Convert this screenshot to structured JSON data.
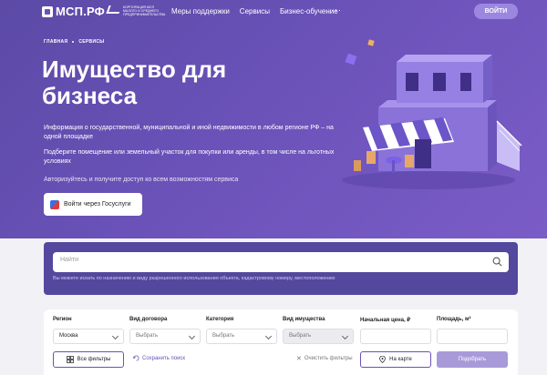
{
  "header": {
    "logo": "МСП.РФ",
    "corp_caption": "Корпорация МСП малого и среднего предпринимательства",
    "nav": [
      "Меры поддержки",
      "Сервисы",
      "Бизнес-обучение"
    ],
    "more": "···",
    "login_label": "ВОЙТИ"
  },
  "breadcrumb": [
    "ГЛАВНАЯ",
    "СЕРВИСЫ"
  ],
  "hero": {
    "title": "Имущество для бизнеса",
    "desc1": "Информация о государственной, муниципальной и иной недвижимости в любом регионе РФ – на одной площадке",
    "desc2": "Подберите помещение или земельный участок для покупки или аренды, в том числе на льготных условиях",
    "desc3": "Авторизуйтесь и получите доступ ко всем возможностям сервиса",
    "gos_button": "Войти через Госуслуги"
  },
  "search": {
    "placeholder": "Найти",
    "hint": "Вы можете искать по назначению и виду разрешенного использования объекта, кадастровому номеру, местоположению"
  },
  "filters": {
    "region": {
      "label": "Регион",
      "value": "Москва"
    },
    "contract": {
      "label": "Вид договора",
      "value": "Выбрать"
    },
    "category": {
      "label": "Категория",
      "value": "Выбрать"
    },
    "property": {
      "label": "Вид имущества",
      "value": "Выбрать"
    },
    "price": {
      "label": "Начальная цена, ₽"
    },
    "area": {
      "label": "Площадь, м²"
    },
    "all_filters": "Все фильтры",
    "save_search": "Сохранить поиск",
    "clear_filters": "Очистить фильтры",
    "on_map": "На карте",
    "apply": "Подобрать"
  },
  "colors": {
    "hero": "#6a52b8",
    "search_card": "#53489e",
    "accent": "#9b87e0"
  }
}
